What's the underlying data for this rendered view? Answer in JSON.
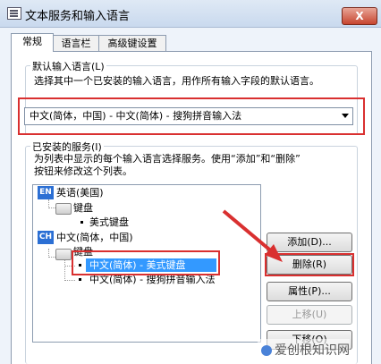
{
  "window": {
    "title": "文本服务和输入语言",
    "close_label": "X"
  },
  "tabs": [
    {
      "label": "常规",
      "active": true
    },
    {
      "label": "语言栏",
      "active": false
    },
    {
      "label": "高级键设置",
      "active": false
    }
  ],
  "default_input": {
    "legend": "默认输入语言(L)",
    "description": "选择其中一个已安装的输入语言，用作所有输入字段的默认语言。",
    "selected_value": "中文(简体，中国) - 中文(简体) - 搜狗拼音输入法"
  },
  "installed_services": {
    "legend": "已安装的服务(I)",
    "description_line1": "为列表中显示的每个输入语言选择服务。使用“添加”和“删除”",
    "description_line2": "按钮来修改这个列表。",
    "tree": {
      "lang1": {
        "badge": "EN",
        "label": "英语(美国)"
      },
      "lang1_group": "键盘",
      "lang1_item1": "美式键盘",
      "lang2": {
        "badge": "CH",
        "label": "中文(简体，中国)"
      },
      "lang2_group": "键盘",
      "lang2_item1": "中文(简体) - 美式键盘",
      "lang2_item2": "中文(简体) - 搜狗拼音输入法"
    },
    "buttons": {
      "add": "添加(D)...",
      "remove": "删除(R)",
      "properties": "属性(P)...",
      "move_up": "上移(U)",
      "move_down": "下移(O)"
    }
  },
  "watermark": {
    "text": "爱创根知识网"
  },
  "colors": {
    "selection": "#3399ff",
    "annotation_red": "#d93030",
    "lang_badge": "#2b6fd4"
  }
}
